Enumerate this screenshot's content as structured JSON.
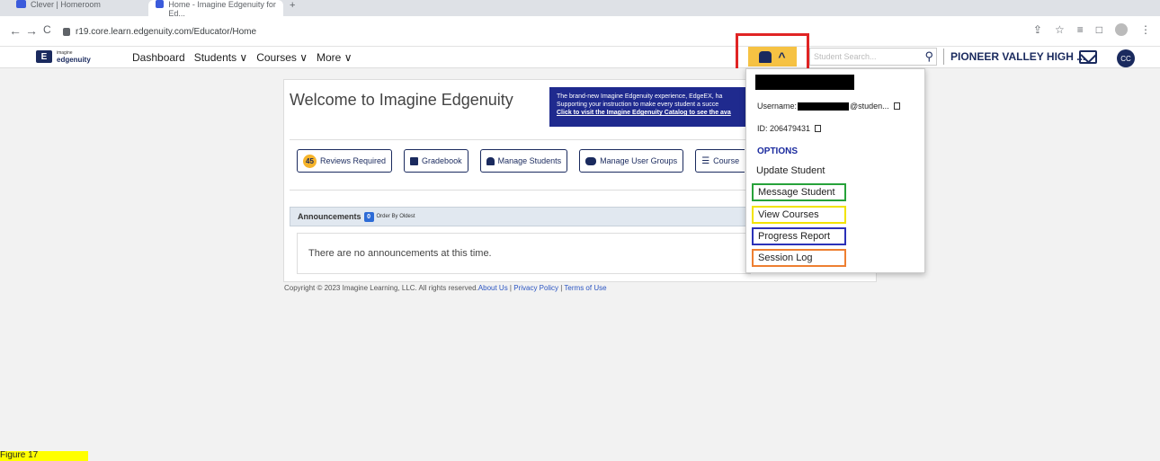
{
  "browser": {
    "tabs": [
      {
        "label": "Clever | Homeroom",
        "active": false
      },
      {
        "label": "Home - Imagine Edgenuity for Ed...",
        "active": true
      }
    ],
    "url": "r19.core.learn.edgenuity.com/Educator/Home"
  },
  "app_nav": {
    "logo_small": "imagine",
    "logo_big": "edgenuity",
    "links": [
      "Dashboard",
      "Students ∨",
      "Courses ∨",
      "More ∨"
    ],
    "search_placeholder": "Student Search...",
    "school": "PIONEER VALLEY HIGH ...",
    "avatar_initials": "CC"
  },
  "welcome": {
    "title": "Welcome to Imagine Edgenuity",
    "banner_line1": "The brand-new Imagine Edgenuity experience, EdgeEX, ha",
    "banner_line2": "Supporting your instruction to make every student a succe",
    "banner_link": "Click to visit the Imagine Edgenuity Catalog to see the ava"
  },
  "quick_buttons": [
    {
      "badge": "45",
      "label": "Reviews Required"
    },
    {
      "label": "Gradebook"
    },
    {
      "label": "Manage Students"
    },
    {
      "label": "Manage User Groups"
    },
    {
      "label": "Course"
    }
  ],
  "announcements": {
    "title": "Announcements",
    "count": "0",
    "order": "Order By Oldest",
    "empty_text": "There are no announcements at this time."
  },
  "footer": {
    "copyright": "Copyright © 2023 Imagine Learning, LLC. All rights reserved.",
    "links": [
      "About Us",
      "Privacy Policy",
      "Terms of Use"
    ]
  },
  "student_menu": {
    "username_label": "Username:",
    "username_suffix": "@studen...",
    "id_text": "ID: 206479431",
    "options_header": "OPTIONS",
    "items": [
      "Update Student",
      "Message Student",
      "View Courses",
      "Progress Report",
      "Session Log"
    ],
    "highlight_colors": {
      "picker": "#e02424",
      "Message Student": "#27a23a",
      "View Courses": "#f2e300",
      "Progress Report": "#2b31b8",
      "Session Log": "#ee7f31"
    }
  },
  "caption": "Figure 17"
}
